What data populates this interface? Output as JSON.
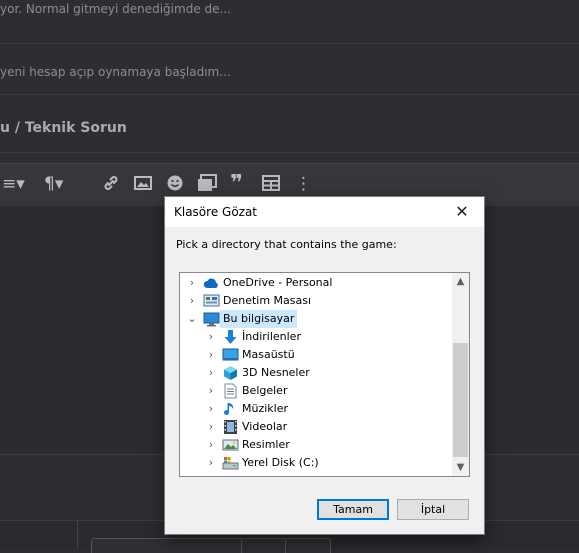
{
  "background": {
    "line1": "yor. Normal gitmeyi denediğimde de...",
    "line2": "yeni hesap açıp oynamaya başladım...",
    "heading": "u / Teknik Sorun",
    "toolbar_icons": [
      "align-icon",
      "paragraph-icon",
      "link-icon",
      "image-icon",
      "smiley-icon",
      "media-icon",
      "quote-icon",
      "table-icon",
      "more-icon"
    ]
  },
  "dialog": {
    "title": "Klasöre Gözat",
    "close_glyph": "✕",
    "prompt": "Pick a directory that contains the game:",
    "tree": [
      {
        "label": "OneDrive - Personal",
        "icon": "onedrive-cloud-icon",
        "level": 0,
        "chevron": "›",
        "selected": false
      },
      {
        "label": "Denetim Masası",
        "icon": "control-panel-icon",
        "level": 0,
        "chevron": "›",
        "selected": false
      },
      {
        "label": "Bu bilgisayar",
        "icon": "computer-icon",
        "level": 0,
        "chevron": "⌄",
        "selected": true
      },
      {
        "label": "İndirilenler",
        "icon": "downloads-icon",
        "level": 1,
        "chevron": "›",
        "selected": false
      },
      {
        "label": "Masaüstü",
        "icon": "desktop-icon",
        "level": 1,
        "chevron": "›",
        "selected": false
      },
      {
        "label": "3D Nesneler",
        "icon": "3d-objects-icon",
        "level": 1,
        "chevron": "›",
        "selected": false
      },
      {
        "label": "Belgeler",
        "icon": "documents-icon",
        "level": 1,
        "chevron": "›",
        "selected": false
      },
      {
        "label": "Müzikler",
        "icon": "music-icon",
        "level": 1,
        "chevron": "›",
        "selected": false
      },
      {
        "label": "Videolar",
        "icon": "videos-icon",
        "level": 1,
        "chevron": "›",
        "selected": false
      },
      {
        "label": "Resimler",
        "icon": "pictures-icon",
        "level": 1,
        "chevron": "›",
        "selected": false
      },
      {
        "label": "Yerel Disk (C:)",
        "icon": "local-disk-icon",
        "level": 1,
        "chevron": "›",
        "selected": false
      }
    ],
    "ok_label": "Tamam",
    "cancel_label": "İptal"
  },
  "colors": {
    "selection": "#cce8ff",
    "default_button_border": "#0078d7",
    "page_background": "#2d2e33"
  }
}
